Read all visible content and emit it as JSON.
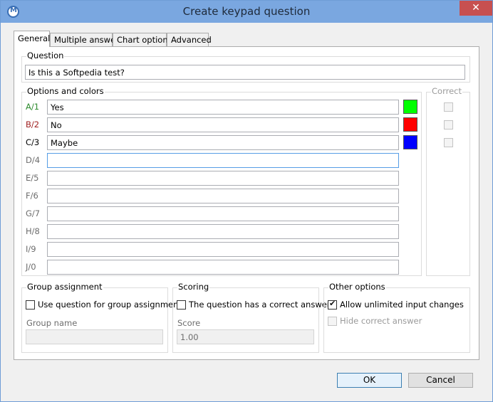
{
  "window": {
    "title": "Create keypad question",
    "close_glyph": "✕"
  },
  "tabs": [
    {
      "label": "General",
      "active": true
    },
    {
      "label": "Multiple answers"
    },
    {
      "label": "Chart options"
    },
    {
      "label": "Advanced"
    }
  ],
  "question": {
    "group_label": "Question",
    "value": "Is this a Softpedia test?"
  },
  "options": {
    "group_label": "Options and colors",
    "rows": [
      {
        "label": "A/1",
        "value": "Yes",
        "label_color": "#2e8b2e",
        "swatch": "#00ff00"
      },
      {
        "label": "B/2",
        "value": "No",
        "label_color": "#a02020",
        "swatch": "#ff0000"
      },
      {
        "label": "C/3",
        "value": "Maybe",
        "label_color": "#000000",
        "swatch": "#0000ff"
      },
      {
        "label": "D/4",
        "value": ""
      },
      {
        "label": "E/5",
        "value": ""
      },
      {
        "label": "F/6",
        "value": ""
      },
      {
        "label": "G/7",
        "value": ""
      },
      {
        "label": "H/8",
        "value": ""
      },
      {
        "label": "I/9",
        "value": ""
      },
      {
        "label": "J/0",
        "value": ""
      }
    ]
  },
  "correct": {
    "group_label": "Correct"
  },
  "group_assignment": {
    "group_label": "Group assignment",
    "checkbox_label": "Use question for group assignment",
    "group_name_label": "Group name",
    "group_name_value": ""
  },
  "scoring": {
    "group_label": "Scoring",
    "checkbox_label": "The question has a correct answer",
    "score_label": "Score",
    "score_value": "1.00"
  },
  "other_options": {
    "group_label": "Other options",
    "allow_label": "Allow unlimited input changes",
    "hide_label": "Hide correct answer"
  },
  "buttons": {
    "ok": "OK",
    "cancel": "Cancel"
  }
}
